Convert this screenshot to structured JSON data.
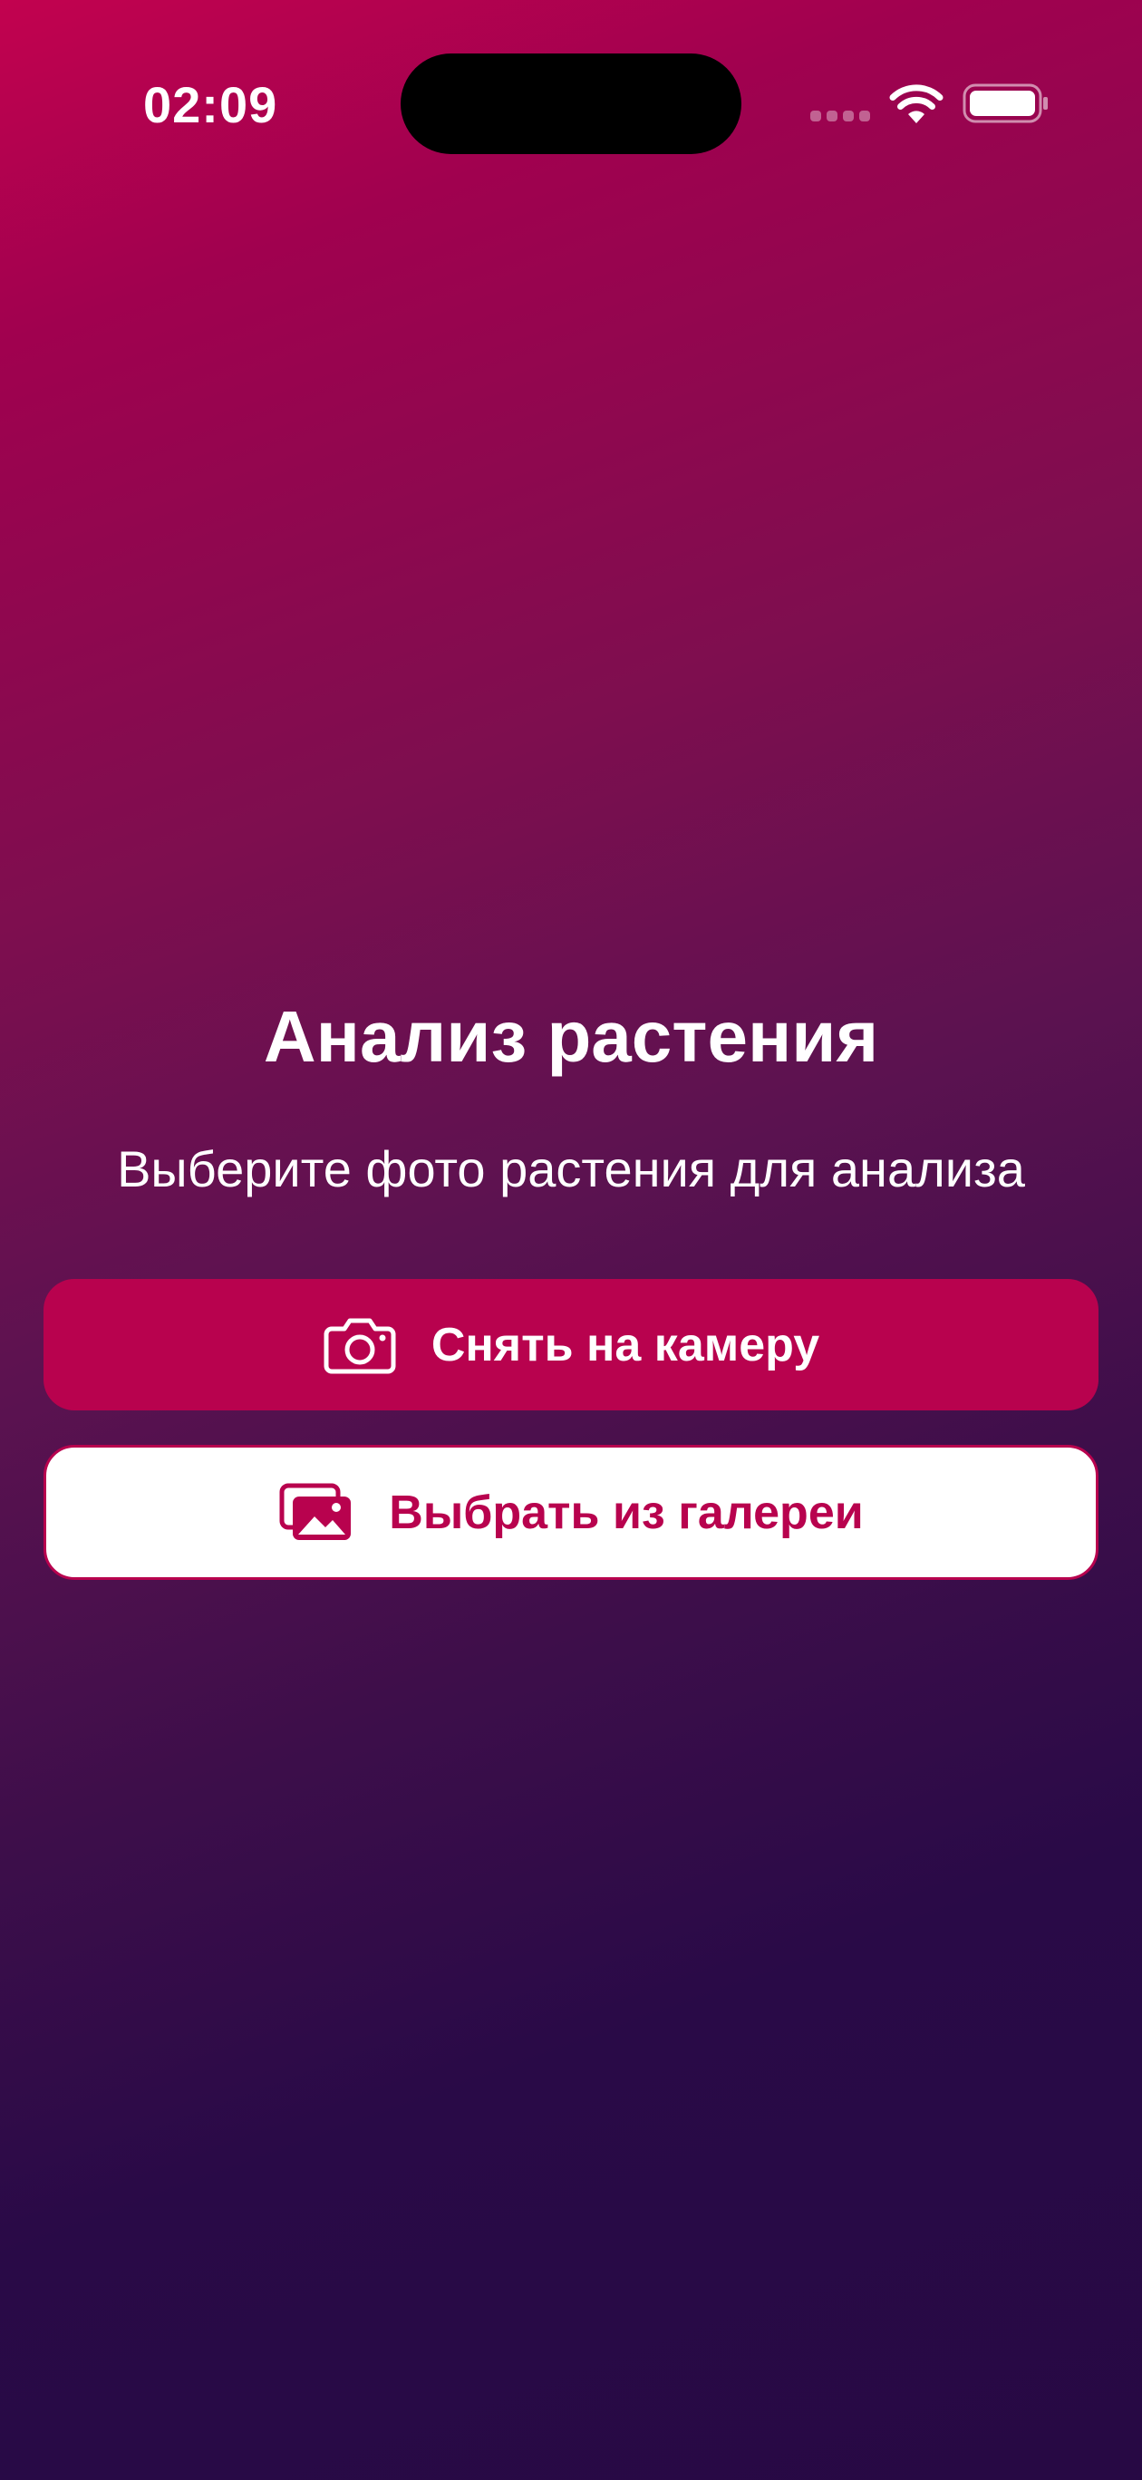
{
  "status_bar": {
    "time": "02:09",
    "wifi_icon": "wifi-icon",
    "battery_icon": "battery-icon",
    "signal_icon": "cellular-signal-icon"
  },
  "main": {
    "title": "Анализ растения",
    "subtitle": "Выберите фото растения для анализа"
  },
  "actions": {
    "camera": {
      "label": "Снять на камеру",
      "icon": "camera-icon"
    },
    "gallery": {
      "label": "Выбрать из галереи",
      "icon": "photo-gallery-icon"
    }
  },
  "colors": {
    "accent": "#b8024e",
    "gradient_top": "#c2024f",
    "gradient_bottom": "#270944",
    "button_secondary_bg": "#ffffff",
    "text_primary": "#ffffff"
  }
}
